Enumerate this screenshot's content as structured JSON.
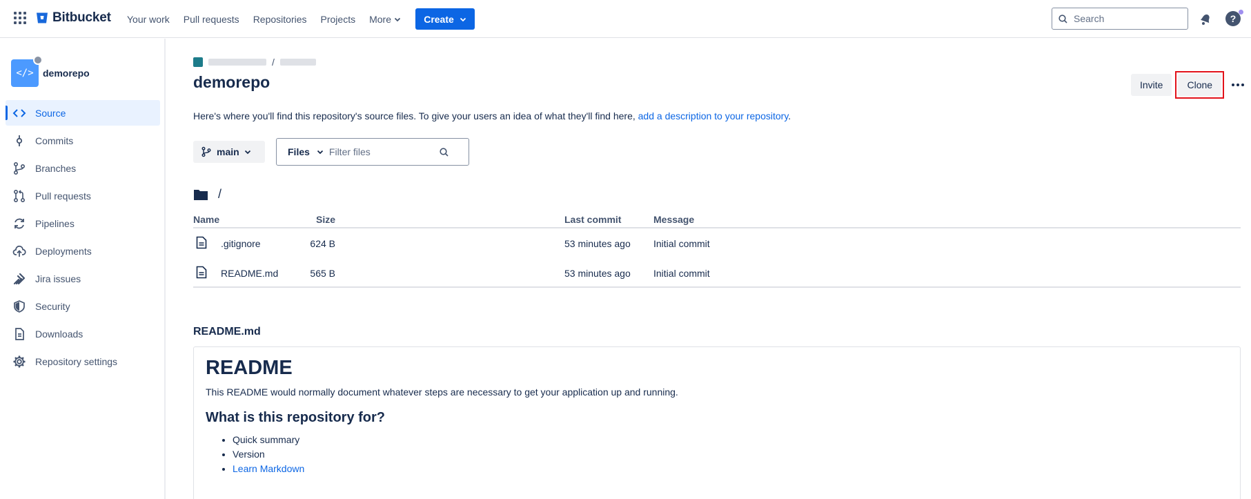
{
  "topnav": {
    "brand": "Bitbucket",
    "links": [
      "Your work",
      "Pull requests",
      "Repositories",
      "Projects"
    ],
    "more_label": "More",
    "create_label": "Create",
    "search_placeholder": "Search"
  },
  "sidebar": {
    "repo_name": "demorepo",
    "items": [
      {
        "label": "Source",
        "icon": "code-icon",
        "active": true
      },
      {
        "label": "Commits",
        "icon": "commit-icon",
        "active": false
      },
      {
        "label": "Branches",
        "icon": "branch-icon",
        "active": false
      },
      {
        "label": "Pull requests",
        "icon": "pull-request-icon",
        "active": false
      },
      {
        "label": "Pipelines",
        "icon": "pipelines-icon",
        "active": false
      },
      {
        "label": "Deployments",
        "icon": "deployments-icon",
        "active": false
      },
      {
        "label": "Jira issues",
        "icon": "jira-icon",
        "active": false
      },
      {
        "label": "Security",
        "icon": "shield-icon",
        "active": false
      },
      {
        "label": "Downloads",
        "icon": "download-file-icon",
        "active": false
      },
      {
        "label": "Repository settings",
        "icon": "gear-icon",
        "active": false
      }
    ]
  },
  "main": {
    "breadcrumb_sep": "/",
    "title": "demorepo",
    "actions": {
      "invite": "Invite",
      "clone": "Clone"
    },
    "description": "Here's where you'll find this repository's source files. To give your users an idea of what they'll find here,",
    "description_link": "add a description to your repository",
    "description_end": ".",
    "branch": "main",
    "files_select": "Files",
    "filter_placeholder": "Filter files",
    "path": "/",
    "table": {
      "headers": {
        "name": "Name",
        "size": "Size",
        "last_commit": "Last commit",
        "message": "Message"
      },
      "rows": [
        {
          "name": ".gitignore",
          "size": "624 B",
          "last_commit": "53 minutes ago",
          "message": "Initial commit"
        },
        {
          "name": "README.md",
          "size": "565 B",
          "last_commit": "53 minutes ago",
          "message": "Initial commit"
        }
      ]
    },
    "readme": {
      "label": "README.md",
      "h1": "README",
      "intro": "This README would normally document whatever steps are necessary to get your application up and running.",
      "h2": "What is this repository for?",
      "list": [
        "Quick summary",
        "Version"
      ],
      "link_item": "Learn Markdown"
    }
  },
  "colors": {
    "accent": "#0c66e4",
    "highlight": "#e2121a",
    "text": "#172b4d"
  }
}
